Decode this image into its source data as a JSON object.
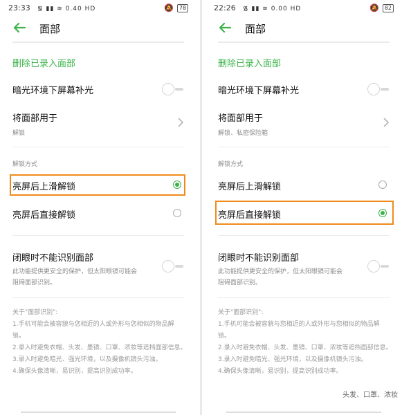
{
  "panels": [
    {
      "status": {
        "time": "23:33",
        "signal": "᯾ ▮▮ ≋ 0.40 HD",
        "battery": "78"
      },
      "title": "面部",
      "delete_label": "删除已录入面部",
      "dim_light": {
        "label": "暗光环境下屏幕补光",
        "on": false
      },
      "use_for": {
        "label": "将面部用于",
        "value": "解锁"
      },
      "section_label": "解锁方式",
      "option_swipe": {
        "label": "亮屏后上滑解锁",
        "selected": true
      },
      "option_direct": {
        "label": "亮屏后直接解锁",
        "selected": false
      },
      "eyes_closed": {
        "label": "闭眼时不能识别面部",
        "desc1": "此功能提供更安全的保护，但太阳眼镜可能会",
        "desc2": "阻碍面部识别。",
        "on": false
      },
      "about": {
        "title": "关于\"面部识别\":",
        "l1": "1.手机可能会被容貌与您相近的人或外形与您相似的物品解",
        "l1b": "锁。",
        "l2": "2.录入时避免衣帽、头发、墨镜、口罩、浓妆等遮挡面部信息。",
        "l3": "3.录入时避免暗光、强光环境，以及摄像机镜头污浊。",
        "l4": "4.确保头像清晰，易识别，提高识别成功率。"
      }
    },
    {
      "status": {
        "time": "22:26",
        "signal": "᯾ ▮▮ ≋ 0.00 HD",
        "battery": "82"
      },
      "title": "面部",
      "delete_label": "删除已录入面部",
      "dim_light": {
        "label": "暗光环境下屏幕补光",
        "on": false
      },
      "use_for": {
        "label": "将面部用于",
        "value": "解锁、私密保险箱"
      },
      "section_label": "解锁方式",
      "option_swipe": {
        "label": "亮屏后上滑解锁",
        "selected": false
      },
      "option_direct": {
        "label": "亮屏后直接解锁",
        "selected": true
      },
      "eyes_closed": {
        "label": "闭眼时不能识别面部",
        "desc1": "此功能提供更安全的保护，但太阳眼镜可能会",
        "desc2": "阻碍面部识别。",
        "on": false
      },
      "about": {
        "title": "关于\"面部识别\":",
        "l1": "1.手机可能会被容貌与您相近的人或外形与您相似的物品解",
        "l1b": "锁。",
        "l2": "2.录入时避免衣帽、头发、墨镜、口罩、浓妆等遮挡面部信息。",
        "l3": "3.录入时避免暗光、强光环境，以及摄像机镜头污浊。",
        "l4": "4.确保头像清晰，易识别，提高识别成功率。"
      },
      "watermark": "头发、口罩、浓妆"
    }
  ],
  "colors": {
    "accent": "#3bb34a",
    "highlight": "#f08a1a",
    "muted": "#8d8d8d"
  }
}
